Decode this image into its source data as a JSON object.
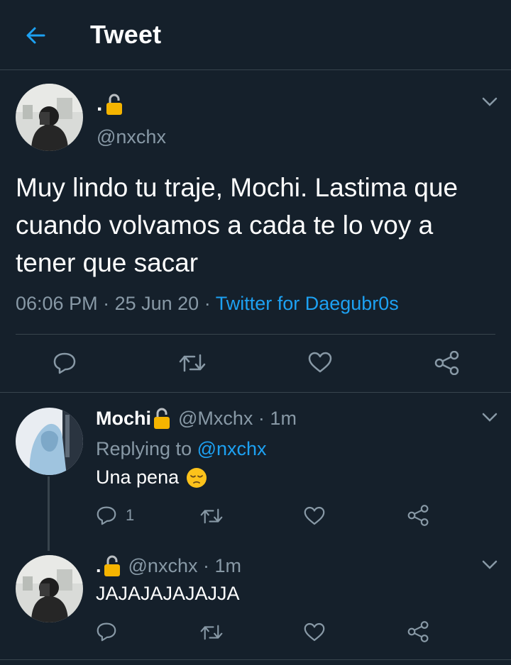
{
  "header": {
    "title": "Tweet",
    "back_icon": "arrow-left-icon"
  },
  "main_tweet": {
    "name": ".",
    "handle": "@nxchx",
    "text": "Muy lindo tu traje, Mochi. Lastima que cuando volvamos a cada te lo voy a tener que sacar",
    "time": "06:06 PM",
    "date": "25 Jun 20",
    "source": "Twitter for Daegubr0s",
    "sep": " · "
  },
  "replies": [
    {
      "name": "Mochi",
      "handle": "@Mxchx",
      "time": "1m",
      "replying_label": "Replying to ",
      "replying_to": "@nxchx",
      "text": "Una pena",
      "reply_count": "1"
    },
    {
      "name": ".",
      "handle": "@nxchx",
      "time": "1m",
      "text": "JAJAJAJAJAJJA"
    }
  ],
  "colors": {
    "background": "#15202b",
    "accent": "#1da1f2",
    "muted": "#8899a6",
    "divider": "#38444d",
    "lock": "#f5b400"
  }
}
